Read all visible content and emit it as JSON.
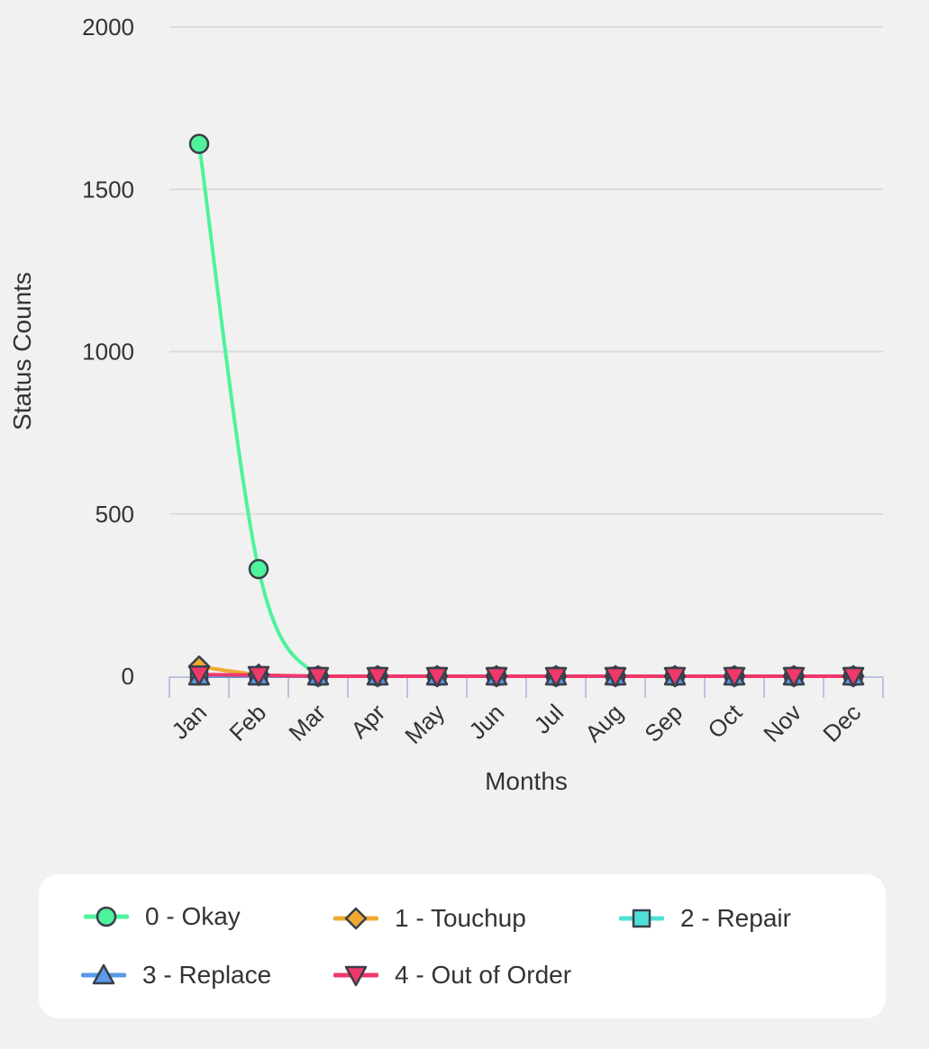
{
  "chart_data": {
    "type": "line",
    "title": "",
    "xlabel": "Months",
    "ylabel": "Status Counts",
    "categories": [
      "Jan",
      "Feb",
      "Mar",
      "Apr",
      "May",
      "Jun",
      "Jul",
      "Aug",
      "Sep",
      "Oct",
      "Nov",
      "Dec"
    ],
    "ylim": [
      0,
      2000
    ],
    "yticks": [
      0,
      500,
      1000,
      1500,
      2000
    ],
    "grid": true,
    "legend_position": "bottom",
    "series": [
      {
        "name": "0 - Okay",
        "marker": "circle",
        "color": "#4ef39b",
        "values": [
          1640,
          330,
          0,
          0,
          0,
          0,
          0,
          0,
          0,
          0,
          0,
          0
        ]
      },
      {
        "name": "1 - Touchup",
        "marker": "diamond",
        "color": "#f0a930",
        "values": [
          30,
          5,
          0,
          0,
          0,
          0,
          0,
          0,
          0,
          0,
          0,
          0
        ]
      },
      {
        "name": "2 - Repair",
        "marker": "square",
        "color": "#4ee0d6",
        "values": [
          0,
          0,
          0,
          0,
          0,
          0,
          0,
          0,
          0,
          0,
          0,
          0
        ]
      },
      {
        "name": "3 - Replace",
        "marker": "triangle-up",
        "color": "#5a9ae6",
        "values": [
          0,
          0,
          0,
          0,
          0,
          0,
          0,
          0,
          0,
          0,
          0,
          0
        ]
      },
      {
        "name": "4 - Out of Order",
        "marker": "triangle-down",
        "color": "#f0386b",
        "values": [
          5,
          3,
          0,
          0,
          0,
          0,
          0,
          0,
          0,
          0,
          0,
          0
        ]
      }
    ]
  }
}
